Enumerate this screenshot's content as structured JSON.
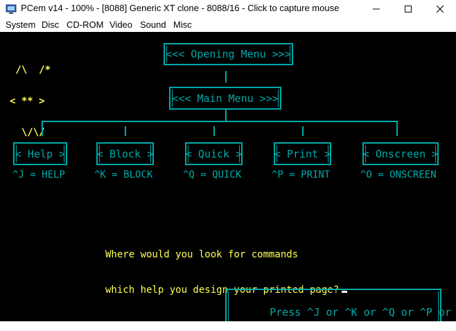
{
  "window": {
    "title": "PCem v14 - 100% - [8088] Generic XT clone - 8088/16 - Click to capture mouse",
    "minimize": "—",
    "maximize": "☐",
    "close": "✕"
  },
  "menu": [
    "System",
    "Disc",
    "CD-ROM",
    "Video",
    "Sound",
    "Misc"
  ],
  "screen": {
    "logo": [
      " /\\  /*",
      "< ** >",
      "  \\/\\/"
    ],
    "logo_star": "*",
    "opening_menu": "<<< Opening Menu >>>",
    "main_menu": "<<< Main Menu >>>",
    "submenus": [
      {
        "label": "< Help >",
        "command": "^J = HELP"
      },
      {
        "label": "< Block >",
        "command": "^K = BLOCK"
      },
      {
        "label": "< Quick >",
        "command": "^Q = QUICK"
      },
      {
        "label": "< Print >",
        "command": "^P = PRINT"
      },
      {
        "label": "< Onscreen >",
        "command": "^O = ONSCREEN"
      }
    ],
    "question_line1": "Where would you look for commands",
    "question_line2": "which help you design your printed page?",
    "press_prompt": "Press ^J or ^K or ^Q or ^P or ^O"
  },
  "colors": {
    "screen_bg": "#000000",
    "cyan": "#00aaaa",
    "yellow": "#ffff55"
  }
}
